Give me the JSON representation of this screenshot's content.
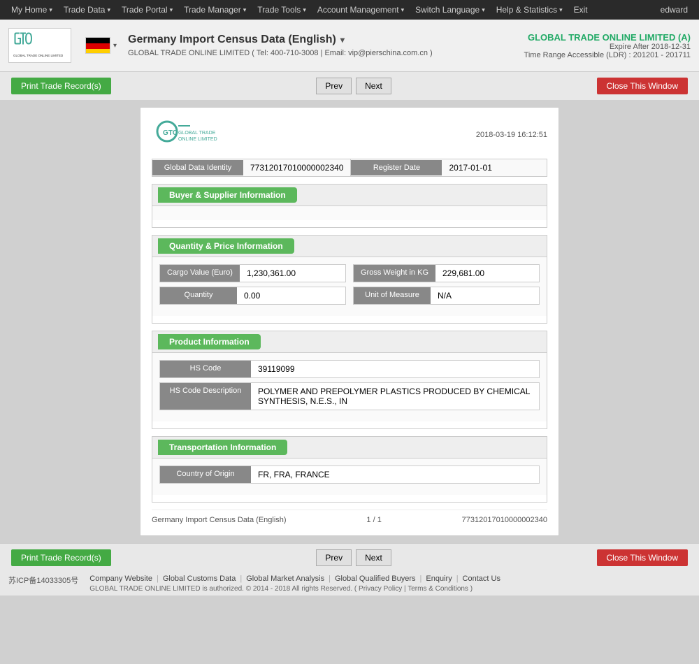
{
  "topnav": {
    "items": [
      {
        "label": "My Home",
        "id": "my-home"
      },
      {
        "label": "Trade Data",
        "id": "trade-data"
      },
      {
        "label": "Trade Portal",
        "id": "trade-portal"
      },
      {
        "label": "Trade Manager",
        "id": "trade-manager"
      },
      {
        "label": "Trade Tools",
        "id": "trade-tools"
      },
      {
        "label": "Account Management",
        "id": "account-mgmt"
      },
      {
        "label": "Switch Language",
        "id": "switch-lang"
      },
      {
        "label": "Help & Statistics",
        "id": "help-stats"
      },
      {
        "label": "Exit",
        "id": "exit"
      }
    ],
    "username": "edward"
  },
  "header": {
    "title": "Germany Import Census Data (English)",
    "company_line": "GLOBAL TRADE ONLINE LIMITED ( Tel: 400-710-3008 | Email: vip@pierschina.com.cn )",
    "company_name": "GLOBAL TRADE ONLINE LIMITED (A)",
    "expire": "Expire After 2018-12-31",
    "time_range": "Time Range Accessible (LDR) : 201201 - 201711"
  },
  "toolbar": {
    "print_label": "Print Trade Record(s)",
    "prev_label": "Prev",
    "next_label": "Next",
    "close_label": "Close This Window"
  },
  "record": {
    "timestamp": "2018-03-19 16:12:51",
    "global_data_identity_label": "Global Data Identity",
    "global_data_identity_value": "77312017010000002340",
    "register_date_label": "Register Date",
    "register_date_value": "2017-01-01",
    "sections": {
      "buyer_supplier": {
        "title": "Buyer & Supplier Information",
        "fields": []
      },
      "quantity_price": {
        "title": "Quantity & Price Information",
        "fields": [
          {
            "label": "Cargo Value (Euro)",
            "value": "1,230,361.00"
          },
          {
            "label": "Gross Weight in KG",
            "value": "229,681.00"
          },
          {
            "label": "Quantity",
            "value": "0.00"
          },
          {
            "label": "Unit of Measure",
            "value": "N/A"
          }
        ]
      },
      "product": {
        "title": "Product Information",
        "fields": [
          {
            "label": "HS Code",
            "value": "39119099"
          },
          {
            "label": "HS Code Description",
            "value": "POLYMER AND PREPOLYMER PLASTICS PRODUCED BY CHEMICAL SYNTHESIS, N.E.S., IN"
          }
        ]
      },
      "transportation": {
        "title": "Transportation Information",
        "fields": [
          {
            "label": "Country of Origin",
            "value": "FR, FRA, FRANCE"
          }
        ]
      }
    },
    "footer": {
      "left": "Germany Import Census Data (English)",
      "center": "1 / 1",
      "right": "77312017010000002340"
    }
  },
  "footer": {
    "icp": "苏ICP备14033305号",
    "links": [
      "Company Website",
      "Global Customs Data",
      "Global Market Analysis",
      "Global Qualified Buyers",
      "Enquiry",
      "Contact Us"
    ],
    "copyright": "GLOBAL TRADE ONLINE LIMITED is authorized. © 2014 - 2018 All rights Reserved.  (  Privacy Policy  |  Terms & Conditions  )"
  }
}
